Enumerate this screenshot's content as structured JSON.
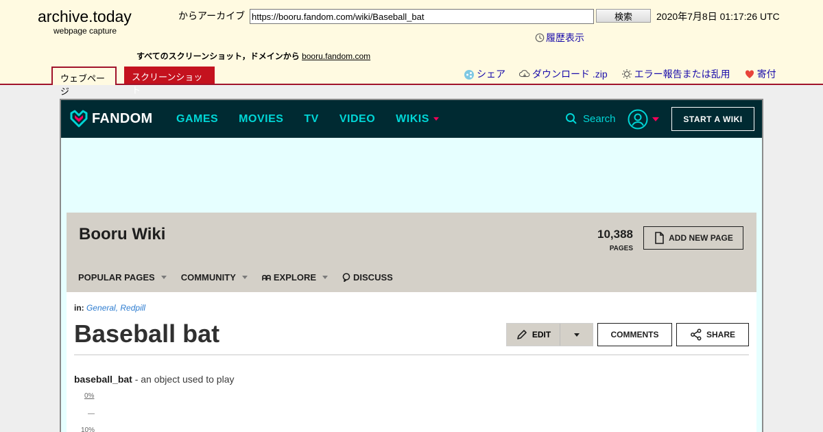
{
  "archive": {
    "logo": "archive.today",
    "logo_sub": "webpage capture",
    "from_label": "からアーカイブ",
    "url_value": "https://booru.fandom.com/wiki/Baseball_bat",
    "search_label": "検索",
    "date": "2020年7月8日 01:17:26 UTC",
    "history_label": "履歴表示",
    "all_screenshots_label": "すべてのスクリーンショット，ドメインから",
    "domain_link": "booru.fandom.com",
    "tabs": {
      "webpage": "ウェブページ",
      "screenshot": "スクリーンショット"
    },
    "actions": {
      "share": "シェア",
      "download": "ダウンロード .zip",
      "report": "エラー報告または乱用",
      "donate": "寄付"
    },
    "colors": {
      "accent": "#a0122a",
      "link": "#1a0dab",
      "background": "#fffae1"
    }
  },
  "fandom": {
    "logo_text": "FANDOM",
    "nav": [
      "GAMES",
      "MOVIES",
      "TV",
      "VIDEO",
      "WIKIS"
    ],
    "search_label": "Search",
    "start_wiki_label": "START A WIKI",
    "colors": {
      "nav_bg": "#002a32",
      "link": "#00d6d6",
      "caret": "#fa005a"
    }
  },
  "wiki": {
    "name": "Booru Wiki",
    "pages_count": "10,388",
    "pages_label": "PAGES",
    "add_page_label": "ADD NEW PAGE",
    "nav": [
      "POPULAR PAGES",
      "COMMUNITY",
      "EXPLORE",
      "DISCUSS"
    ]
  },
  "article": {
    "in_label": "in:",
    "categories": "General, Redpill",
    "title": "Baseball bat",
    "edit_label": "EDIT",
    "comments_label": "COMMENTS",
    "share_label": "SHARE",
    "term": "baseball_bat",
    "definition": " - an object used to play",
    "pct_top": "0%",
    "pct_dash": "—",
    "pct_bottom": "10%"
  }
}
